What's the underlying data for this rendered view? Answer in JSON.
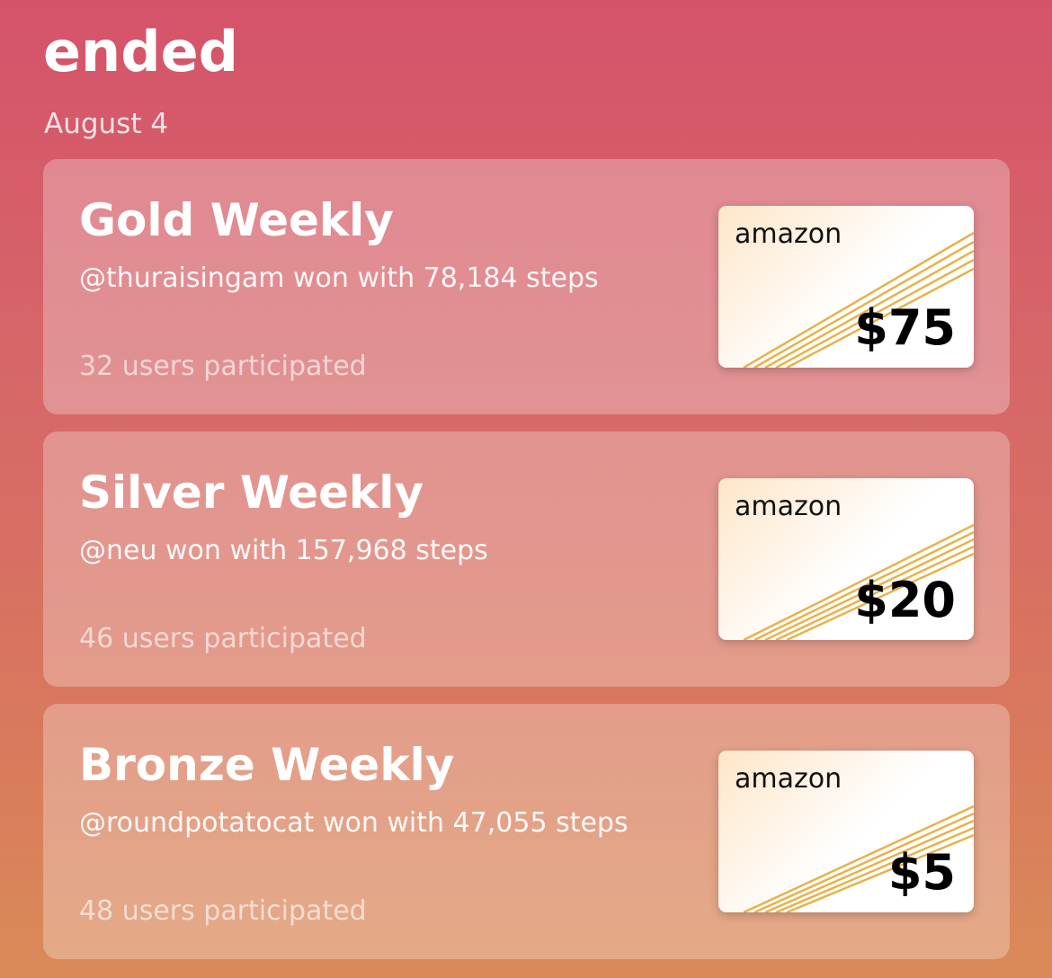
{
  "header": {
    "title": "ended",
    "date": "August 4"
  },
  "colors": {
    "background_top": "#d5536a",
    "background_bottom": "#da8a58",
    "stripe": "#e8b24a"
  },
  "cards": [
    {
      "title": "Gold Weekly",
      "winner": "@thuraisingam won with 78,184 steps",
      "participants": "32 users participated",
      "gift_brand": "amazon",
      "gift_amount": "$75"
    },
    {
      "title": "Silver Weekly",
      "winner": "@neu won with 157,968 steps",
      "participants": "46 users participated",
      "gift_brand": "amazon",
      "gift_amount": "$20"
    },
    {
      "title": "Bronze Weekly",
      "winner": "@roundpotatocat won with 47,055 steps",
      "participants": "48 users participated",
      "gift_brand": "amazon",
      "gift_amount": "$5"
    }
  ]
}
